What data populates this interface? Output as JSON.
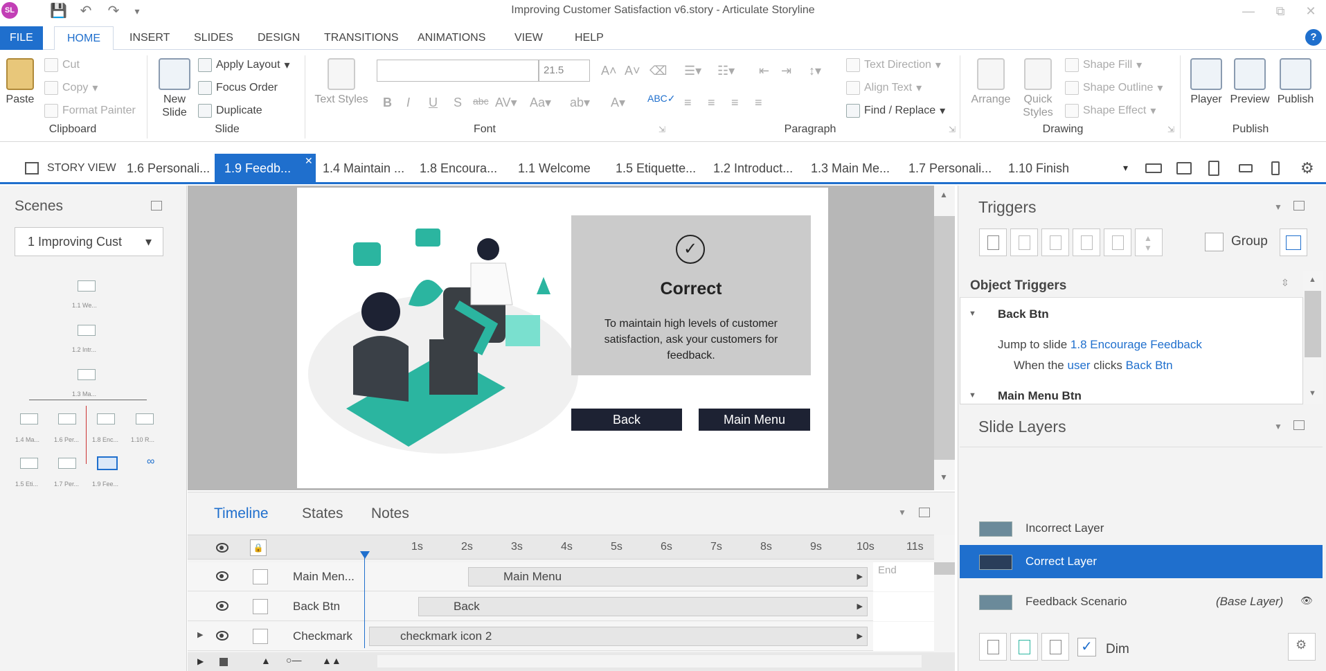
{
  "window": {
    "title": "Improving Customer Satisfaction v6.story -  Articulate Storyline",
    "logo": "SL"
  },
  "ribbon": {
    "tabs": [
      {
        "label": "FILE"
      },
      {
        "label": "HOME"
      },
      {
        "label": "INSERT"
      },
      {
        "label": "SLIDES"
      },
      {
        "label": "DESIGN"
      },
      {
        "label": "TRANSITIONS"
      },
      {
        "label": "ANIMATIONS"
      },
      {
        "label": "VIEW"
      },
      {
        "label": "HELP"
      }
    ],
    "clipboard": {
      "paste": "Paste",
      "cut": "Cut",
      "copy": "Copy",
      "format_painter": "Format Painter",
      "label": "Clipboard"
    },
    "slide": {
      "new_slide": "New Slide",
      "apply_layout": "Apply Layout",
      "focus_order": "Focus Order",
      "duplicate": "Duplicate",
      "label": "Slide"
    },
    "font": {
      "text_styles": "Text Styles",
      "size": "21.5",
      "label": "Font"
    },
    "paragraph": {
      "text_direction": "Text Direction",
      "align_text": "Align Text",
      "find_replace": "Find / Replace",
      "label": "Paragraph"
    },
    "drawing": {
      "arrange": "Arrange",
      "quick_styles": "Quick Styles",
      "shape_fill": "Shape Fill",
      "shape_outline": "Shape Outline",
      "shape_effect": "Shape Effect",
      "label": "Drawing"
    },
    "publish": {
      "player": "Player",
      "preview": "Preview",
      "publish": "Publish",
      "label": "Publish"
    }
  },
  "slide_tabs": {
    "story_view": "STORY VIEW",
    "tabs": [
      {
        "label": "1.6 Personali..."
      },
      {
        "label": "1.9 Feedb..."
      },
      {
        "label": "1.4 Maintain ..."
      },
      {
        "label": "1.8 Encoura..."
      },
      {
        "label": "1.1 Welcome"
      },
      {
        "label": "1.5 Etiquette..."
      },
      {
        "label": "1.2 Introduct..."
      },
      {
        "label": "1.3 Main Me..."
      },
      {
        "label": "1.7 Personali..."
      },
      {
        "label": "1.10 Finish"
      }
    ]
  },
  "scenes": {
    "title": "Scenes",
    "selected": "1 Improving Cust",
    "nodes": [
      {
        "label": "1.1 We..."
      },
      {
        "label": "1.2 Intr..."
      },
      {
        "label": "1.3 Ma..."
      },
      {
        "label": "1.4 Ma..."
      },
      {
        "label": "1.6 Per..."
      },
      {
        "label": "1.8 Enc..."
      },
      {
        "label": "1.10 R..."
      },
      {
        "label": "1.5 Eti..."
      },
      {
        "label": "1.7 Per..."
      },
      {
        "label": "1.9 Fee..."
      }
    ]
  },
  "slide": {
    "heading": "Correct",
    "message": "To maintain high levels of customer satisfaction, ask your customers for feedback.",
    "back_button": "Back",
    "main_menu_button": "Main Menu"
  },
  "timeline": {
    "tabs": [
      {
        "label": "Timeline"
      },
      {
        "label": "States"
      },
      {
        "label": "Notes"
      }
    ],
    "ticks": [
      "1s",
      "2s",
      "3s",
      "4s",
      "5s",
      "6s",
      "7s",
      "8s",
      "9s",
      "10s",
      "11s"
    ],
    "end_label": "End",
    "rows": [
      {
        "name": "Main Men...",
        "bar": "Main Menu"
      },
      {
        "name": "Back Btn",
        "bar": "Back"
      },
      {
        "name": "Checkmark",
        "bar": "checkmark icon 2"
      }
    ]
  },
  "triggers": {
    "title": "Triggers",
    "group_label": "Group",
    "object_triggers": "Object Triggers",
    "items": [
      {
        "object": "Back Btn",
        "action_prefix": "Jump to slide ",
        "action_target": "1.8 Encourage Feedback",
        "when_prefix": "When the ",
        "when_user": "user",
        "when_mid": " clicks ",
        "when_object": "Back Btn"
      },
      {
        "object": "Main Menu Btn"
      }
    ]
  },
  "layers": {
    "title": "Slide Layers",
    "items": [
      {
        "name": "Incorrect Layer",
        "tag": ""
      },
      {
        "name": "Correct Layer",
        "tag": ""
      },
      {
        "name": "Feedback Scenario",
        "tag": "(Base Layer)"
      }
    ],
    "dim_label": "Dim"
  },
  "colors": {
    "accent": "#1f6fcd",
    "slide_button": "#1d2233",
    "feedback_box": "#cbcbcb",
    "illustration": "#2bb5a0"
  }
}
